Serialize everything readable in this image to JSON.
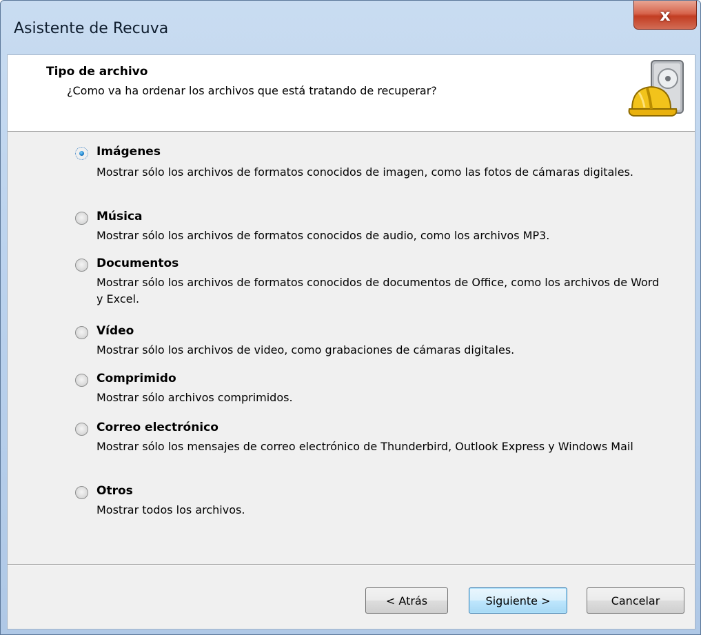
{
  "window": {
    "title": "Asistente de Recuva",
    "close_glyph": "x"
  },
  "header": {
    "title": "Tipo de archivo",
    "subtitle": "¿Como va ha ordenar los archivos que está tratando de recuperar?",
    "icon": "hard-drive-hardhat-icon"
  },
  "options": [
    {
      "label": "Imágenes",
      "description": "Mostrar sólo los archivos de formatos conocidos de imagen, como las fotos de cámaras digitales.",
      "selected": true
    },
    {
      "label": "Música",
      "description": "Mostrar sólo los archivos de formatos conocidos de audio, como los archivos MP3.",
      "selected": false
    },
    {
      "label": "Documentos",
      "description": "Mostrar sólo los archivos de formatos conocidos de documentos de Office, como los archivos de Word y Excel.",
      "selected": false
    },
    {
      "label": "Vídeo",
      "description": "Mostrar sólo los archivos de video, como grabaciones de cámaras digitales.",
      "selected": false
    },
    {
      "label": "Comprimido",
      "description": "Mostrar sólo archivos comprimidos.",
      "selected": false
    },
    {
      "label": "Correo electrónico",
      "description": "Mostrar sólo los mensajes de correo electrónico de Thunderbird, Outlook Express y Windows Mail",
      "selected": false
    },
    {
      "label": "Otros",
      "description": "Mostrar todos los archivos.",
      "selected": false
    }
  ],
  "buttons": {
    "back": "< Atrás",
    "next": "Siguiente >",
    "cancel": "Cancelar"
  }
}
